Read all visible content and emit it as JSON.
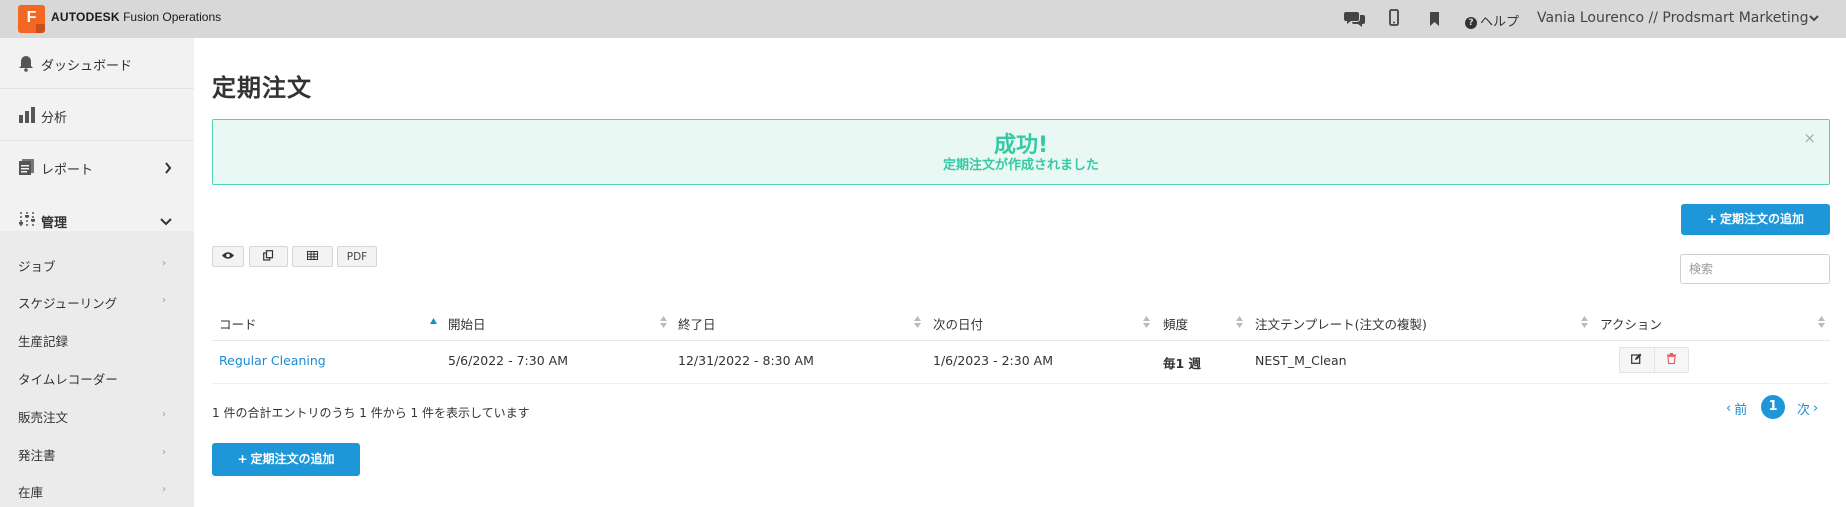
{
  "header": {
    "brand_bold": "AUTODESK",
    "brand_rest": " Fusion Operations",
    "logo_letter": "F",
    "help_label": "ヘルプ",
    "user_label": "Vania Lourenco // Prodsmart Marketing",
    "icons": [
      "chat-icon",
      "mobile-icon",
      "bookmark-icon",
      "help-icon",
      "chevron-down-icon"
    ]
  },
  "sidebar": {
    "dashboard": "ダッシュボード",
    "analytics": "分析",
    "reports": "レポート",
    "management": "管理",
    "sub_items": [
      "ジョブ",
      "スケジューリング",
      "生産記録",
      "タイムレコーダー",
      "販売注文",
      "発注書",
      "在庫"
    ]
  },
  "page": {
    "title": "定期注文",
    "alert_title": "成功!",
    "alert_message": "定期注文が作成されました",
    "alert_close": "×",
    "add_button": "定期注文の追加",
    "pdf_label": "PDF",
    "search_placeholder": "検索"
  },
  "table": {
    "headers": [
      "コード",
      "開始日",
      "終了日",
      "次の日付",
      "頻度",
      "注文テンプレート(注文の複製)",
      "アクション"
    ],
    "rows": [
      {
        "code": "Regular Cleaning",
        "start": "5/6/2022 - 7:30 AM",
        "end": "12/31/2022 - 8:30 AM",
        "next": "1/6/2023 - 2:30 AM",
        "frequency": "毎1 週",
        "template": "NEST_M_Clean"
      }
    ],
    "info": "1 件の合計エントリのうち 1 件から 1 件を表示しています"
  },
  "pagination": {
    "prev": "前",
    "current": "1",
    "next": "次"
  },
  "colors": {
    "primary": "#1d97d8",
    "success": "#36c9a6",
    "brand": "#f26722",
    "delete": "#e05a5a"
  }
}
